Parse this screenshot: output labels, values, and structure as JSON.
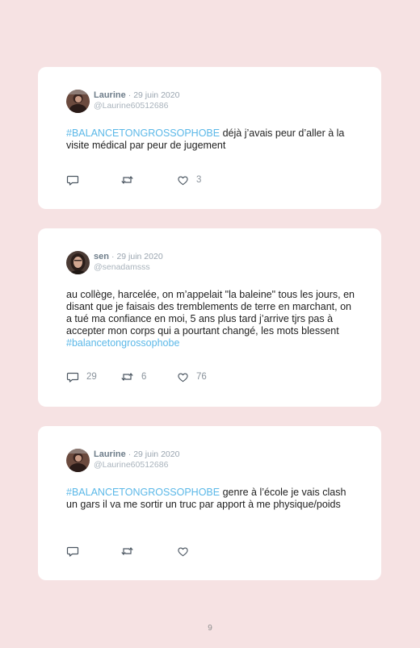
{
  "tweets": [
    {
      "name": "Laurine",
      "date": "· 29 juin 2020",
      "handle": "@Laurine60512686",
      "hashtag": "#BALANCETONGROSSOPHOBE",
      "text": " déjà j’avais peur d’aller à la visite médical par peur de jugement",
      "reply_count": "",
      "retweet_count": "",
      "like_count": "3"
    },
    {
      "name": "sen",
      "date": "· 29 juin 2020",
      "handle": "@senadamsss",
      "text": "au collège, harcelée, on m’appelait \"la baleine\" tous les jours, en disant que je faisais des tremblements de terre en marchant, on a tué ma confiance en moi, 5 ans plus tard j’arrive tjrs pas à accepter mon corps qui a pourtant changé, les mots blessent ",
      "hashtag": "#balancetongrossophobe",
      "reply_count": "29",
      "retweet_count": "6",
      "like_count": "76"
    },
    {
      "name": "Laurine",
      "date": "· 29 juin 2020",
      "handle": "@Laurine60512686",
      "hashtag": "#BALANCETONGROSSOPHOBE",
      "text": " genre à l’école je vais clash un gars il va me sortir un truc par apport à me physique/poids",
      "reply_count": "",
      "retweet_count": "",
      "like_count": ""
    }
  ],
  "page_number": "9",
  "icons": {
    "reply": "reply-icon",
    "retweet": "retweet-icon",
    "like": "heart-icon"
  },
  "colors": {
    "background": "#f6e2e3",
    "hashtag": "#5bb8e8",
    "card": "#ffffff"
  }
}
